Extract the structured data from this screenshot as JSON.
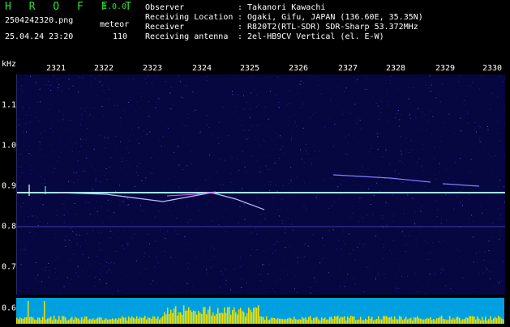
{
  "header": {
    "title": "H R O F F T",
    "version": "1.0.0",
    "filename": "2504242320.png",
    "mode": "meteor",
    "datetime": "25.04.24 23:20",
    "count": "110",
    "info": [
      {
        "label": "Observer",
        "value": ": Takanori Kawachi"
      },
      {
        "label": "Receiving Location",
        "value": ": Ogaki, Gifu, JAPAN (136.60E, 35.35N)"
      },
      {
        "label": "Receiver",
        "value": ": R820T2(RTL-SDR) SDR-Sharp 53.372MHz"
      },
      {
        "label": "Receiving antenna",
        "value": ": 2el-HB9CV Vertical (el. E-W)"
      }
    ]
  },
  "axis": {
    "unit": "kHz",
    "time_labels": [
      "2321",
      "2322",
      "2323",
      "2324",
      "2325",
      "2326",
      "2327",
      "2328",
      "2329",
      "2330"
    ],
    "freq_labels": [
      "1.1",
      "1.0",
      "0.9",
      "0.8",
      "0.7",
      "0.6"
    ]
  },
  "colors": {
    "background": "#060640",
    "carrier": "#9ff0ff",
    "trace": "#c0c0ff",
    "strip": "#00a0e0",
    "bars": "#f0e000",
    "title": "#2fe02f"
  }
}
